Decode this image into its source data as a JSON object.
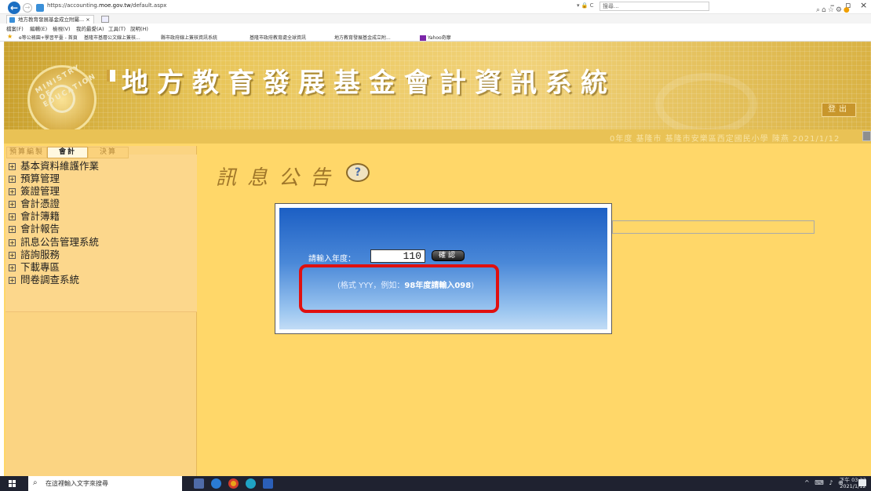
{
  "browser": {
    "url_prefix": "https://accounting.",
    "url_domain": "moe.gov.tw",
    "url_path": "/default.aspx",
    "addr_tools": "▾ 🔒 C",
    "search_placeholder": "搜尋...",
    "tab_title": "地方教育發展基金成立附屬... ×",
    "menu": [
      "檔案(F)",
      "編輯(E)",
      "檢視(V)",
      "我的最愛(A)",
      "工具(T)",
      "說明(H)"
    ],
    "favorites": [
      "e等公務園+學習平臺 - 首頁",
      "基隆市基層公文線上簽核...",
      "縣市政府線上簽核資訊系統",
      "基隆市政府教育處全球資訊",
      "地方教育發展基金成立附...",
      "Yahoo奇摩"
    ]
  },
  "header": {
    "site_title": "地方教育發展基金會計資訊系統",
    "logout_label": "登出",
    "status_text": "0年度   基隆市   基隆市安樂區西定國民小學   陳燕   2021/1/12"
  },
  "sidebar": {
    "tabs": [
      "預算編製",
      "會計",
      "決算"
    ],
    "items": [
      "基本資料維護作業",
      "預算管理",
      "簽證管理",
      "會計憑證",
      "會計簿籍",
      "會計報告",
      "訊息公告管理系統",
      "諮詢服務",
      "下載專區",
      "問卷調查系統"
    ]
  },
  "main": {
    "news_title": "訊息公告",
    "dialog": {
      "year_label": "請輸入年度：",
      "year_value": "110",
      "confirm_label": "確認",
      "hint_prefix": "(格式 YYY，例如：",
      "hint_example": "98年度請輸入098",
      "hint_suffix": ")"
    }
  },
  "taskbar": {
    "search_text": "在這裡輸入文字來搜尋",
    "time": "下午 03:23",
    "date": "2021/1/12"
  },
  "colors": {
    "page_bg": "#ffd769",
    "sidebar_bg": "#fbd482",
    "dialog_top": "#1c5fc4",
    "dialog_bottom": "#c2dcf6",
    "highlight": "#e01010"
  }
}
